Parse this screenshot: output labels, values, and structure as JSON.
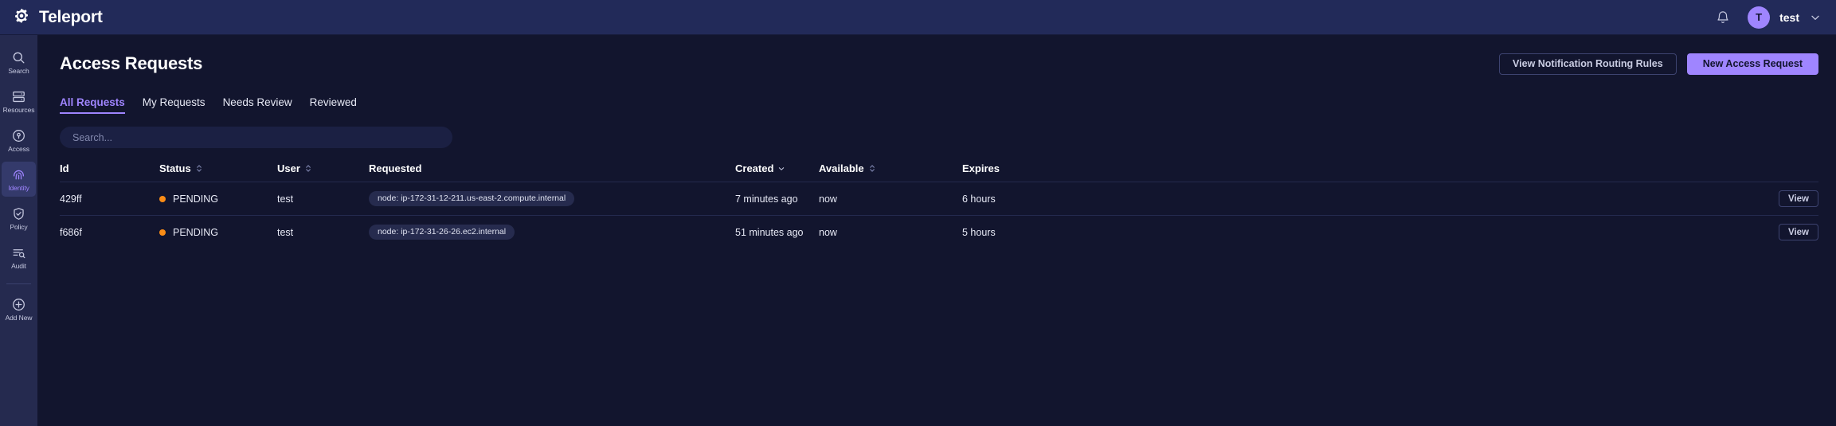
{
  "topbar": {
    "brand": "Teleport",
    "logo_icon": "gear-icon",
    "bell_icon": "bell-icon",
    "avatar_initial": "T",
    "user_name": "test",
    "chevron_icon": "chevron-down-icon"
  },
  "sidebar": {
    "items": [
      {
        "label": "Search",
        "icon": "search-icon",
        "active": false
      },
      {
        "label": "Resources",
        "icon": "server-icon",
        "active": false
      },
      {
        "label": "Access",
        "icon": "lock-circle-icon",
        "active": false
      },
      {
        "label": "Identity",
        "icon": "fingerprint-icon",
        "active": true
      },
      {
        "label": "Policy",
        "icon": "shield-check-icon",
        "active": false
      },
      {
        "label": "Audit",
        "icon": "audit-log-icon",
        "active": false
      },
      {
        "label": "Add New",
        "icon": "plus-circle-icon",
        "active": false
      }
    ]
  },
  "header": {
    "title": "Access Requests",
    "routing_rules_label": "View Notification Routing Rules",
    "new_request_label": "New Access Request"
  },
  "tabs": [
    {
      "label": "All Requests",
      "active": true
    },
    {
      "label": "My Requests",
      "active": false
    },
    {
      "label": "Needs Review",
      "active": false
    },
    {
      "label": "Reviewed",
      "active": false
    }
  ],
  "search": {
    "value": "",
    "placeholder": "Search..."
  },
  "table": {
    "columns": [
      {
        "label": "Id",
        "sortable": false,
        "sort": "none"
      },
      {
        "label": "Status",
        "sortable": true,
        "sort": "none"
      },
      {
        "label": "User",
        "sortable": true,
        "sort": "none"
      },
      {
        "label": "Requested",
        "sortable": false,
        "sort": "none"
      },
      {
        "label": "Created",
        "sortable": true,
        "sort": "desc"
      },
      {
        "label": "Available",
        "sortable": true,
        "sort": "none"
      },
      {
        "label": "Expires",
        "sortable": false,
        "sort": "none"
      }
    ],
    "rows": [
      {
        "id": "429ff",
        "status": "PENDING",
        "status_color": "#fa8c16",
        "user": "test",
        "requested": "node: ip-172-31-12-211.us-east-2.compute.internal",
        "created": "7 minutes ago",
        "available": "now",
        "expires": "6 hours",
        "action": "View"
      },
      {
        "id": "f686f",
        "status": "PENDING",
        "status_color": "#fa8c16",
        "user": "test",
        "requested": "node: ip-172-31-26-26.ec2.internal",
        "created": "51 minutes ago",
        "available": "now",
        "expires": "5 hours",
        "action": "View"
      }
    ]
  },
  "colors": {
    "accent": "#9f85ff",
    "topbar_bg": "#222a59",
    "sidebar_bg": "#252a4f",
    "main_bg": "#12152e",
    "pending": "#fa8c16"
  }
}
